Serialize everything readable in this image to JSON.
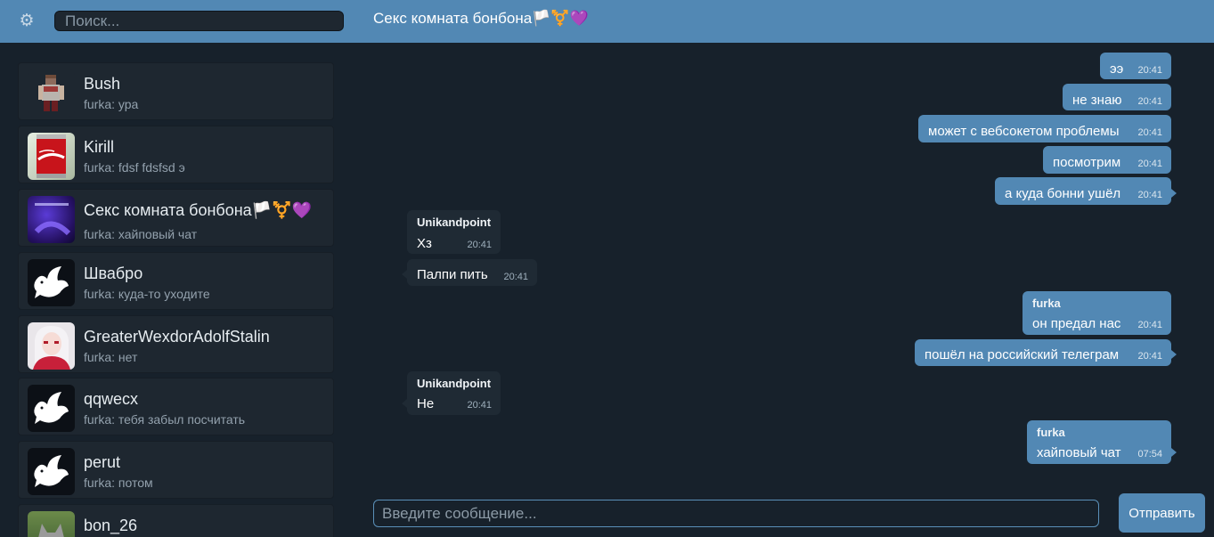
{
  "header": {
    "settings_icon": "gear-icon",
    "search_placeholder": "Поиск...",
    "chat_title": "Секс комната бонбона🏳️⚧️💜"
  },
  "dialogs": [
    {
      "name": "Bush",
      "last": "furka: ура",
      "avatar": "pixel-character"
    },
    {
      "name": "Kirill",
      "last": "furka: fdsf fdsfsd э",
      "avatar": "cola-can"
    },
    {
      "name": "Секс комната бонбона🏳️⚧️💜",
      "last": "furka: хайповый чат",
      "avatar": "purple-image"
    },
    {
      "name": "Швабро",
      "last": "furka: куда-то уходите",
      "avatar": "dove-icon"
    },
    {
      "name": "GreaterWexdorAdolfStalin",
      "last": "furka: нет",
      "avatar": "anime-character"
    },
    {
      "name": "qqwecx",
      "last": "furka: тебя забыл посчитать",
      "avatar": "dove-icon"
    },
    {
      "name": "perut",
      "last": "furka: потом",
      "avatar": "dove-icon"
    },
    {
      "name": "bon_26",
      "last": "",
      "avatar": "wolf-image"
    }
  ],
  "messages": [
    {
      "dir": "out",
      "text": "ээ",
      "time": "20:41"
    },
    {
      "dir": "out",
      "text": "не знаю",
      "time": "20:41"
    },
    {
      "dir": "out",
      "text": "может с вебсокетом проблемы",
      "time": "20:41"
    },
    {
      "dir": "out",
      "text": "посмотрим",
      "time": "20:41"
    },
    {
      "dir": "out",
      "text": "а куда бонни ушёл",
      "time": "20:41"
    },
    {
      "dir": "in",
      "author": "Unikandpoint",
      "text": "Хз",
      "time": "20:41"
    },
    {
      "dir": "in",
      "text": "Палпи пить",
      "time": "20:41"
    },
    {
      "dir": "out",
      "author": "furka",
      "text": "он предал нас",
      "time": "20:41"
    },
    {
      "dir": "out",
      "text": "пошёл на российский телеграм",
      "time": "20:41"
    },
    {
      "dir": "in",
      "author": "Unikandpoint",
      "text": "Не",
      "time": "20:41"
    },
    {
      "dir": "out",
      "author": "furka",
      "text": "хайповый чат",
      "time": "07:54"
    }
  ],
  "composer": {
    "placeholder": "Введите сообщение...",
    "send_label": "Отправить"
  }
}
